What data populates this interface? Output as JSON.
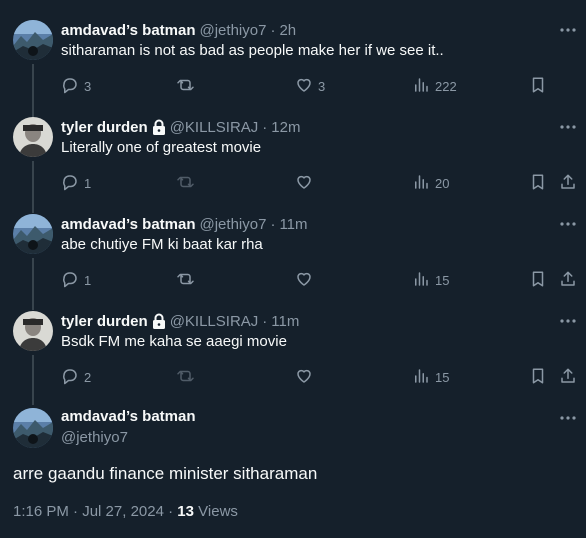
{
  "tweets": [
    {
      "name": "amdavad’s batman",
      "handle": "@jethiyo7",
      "time": "2h",
      "text": "sitharaman is not as bad as people make her if we see it..",
      "replies": "3",
      "retweets": "",
      "likes": "3",
      "views": "222"
    },
    {
      "name": "tyler durden",
      "handle": "@KILLSIRAJ",
      "time": "12m",
      "text": "Literally one of greatest movie",
      "replies": "1",
      "retweets": "",
      "likes": "",
      "views": "20"
    },
    {
      "name": "amdavad’s batman",
      "handle": "@jethiyo7",
      "time": "11m",
      "text": "abe chutiye FM ki baat kar rha",
      "replies": "1",
      "retweets": "",
      "likes": "",
      "views": "15"
    },
    {
      "name": "tyler durden",
      "handle": "@KILLSIRAJ",
      "time": "11m",
      "text": "Bsdk FM me kaha se aaegi movie",
      "replies": "2",
      "retweets": "",
      "likes": "",
      "views": "15"
    }
  ],
  "main_tweet": {
    "name": "amdavad’s batman",
    "handle": "@jethiyo7",
    "text": "arre gaandu finance minister sitharaman",
    "time": "1:16 PM",
    "date": "Jul 27, 2024",
    "views_count": "13",
    "views_label": "Views"
  },
  "separator": "·",
  "icons": {
    "more": "more-dots-icon",
    "reply": "reply-icon",
    "retweet": "retweet-icon",
    "like": "heart-icon",
    "views": "views-chart-icon",
    "bookmark": "bookmark-icon",
    "share": "share-icon",
    "lock": "lock-icon"
  },
  "colors": {
    "background": "#15202b",
    "text": "#f7f9f9",
    "secondary": "#8b98a5",
    "thread_line": "#38444d"
  }
}
